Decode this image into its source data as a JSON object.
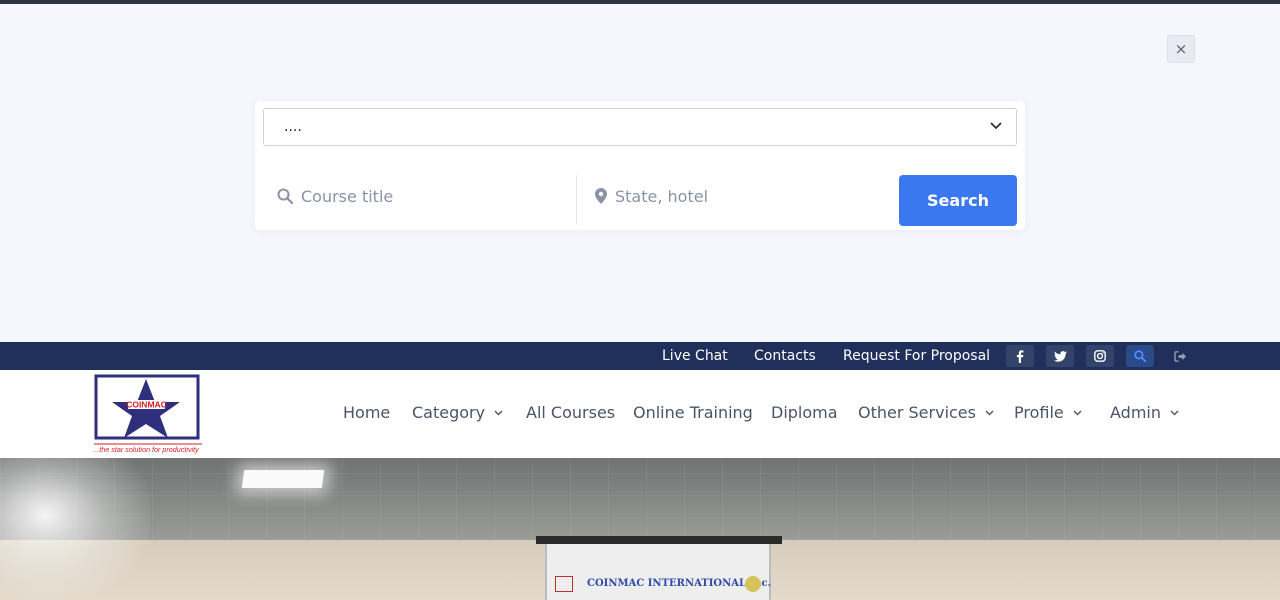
{
  "search_overlay": {
    "close_label": "×",
    "select_value": "....",
    "course_placeholder": "Course title",
    "location_placeholder": "State, hotel",
    "search_button": "Search"
  },
  "topbar": {
    "links": [
      "Live Chat",
      "Contacts",
      "Request For Proposal"
    ],
    "icons": [
      "facebook-icon",
      "twitter-icon",
      "instagram-icon",
      "search-icon",
      "logout-icon"
    ]
  },
  "header": {
    "logo_text": "COINMAC",
    "logo_tagline": "...the star solution for productivity",
    "nav": [
      {
        "label": "Home",
        "has_dropdown": false
      },
      {
        "label": "Category",
        "has_dropdown": true
      },
      {
        "label": "All Courses",
        "has_dropdown": false
      },
      {
        "label": "Online Training",
        "has_dropdown": false
      },
      {
        "label": "Diploma",
        "has_dropdown": false
      },
      {
        "label": "Other Services",
        "has_dropdown": true
      },
      {
        "label": "Profile",
        "has_dropdown": true
      },
      {
        "label": "Admin",
        "has_dropdown": true
      }
    ]
  },
  "hero": {
    "screen_text": "COINMAC INTERNATIONAL Inc."
  },
  "colors": {
    "topbar_bg": "#20305a",
    "accent_blue": "#3b78f0",
    "logo_red": "#d21f26",
    "logo_navy": "#2e2f7d"
  }
}
